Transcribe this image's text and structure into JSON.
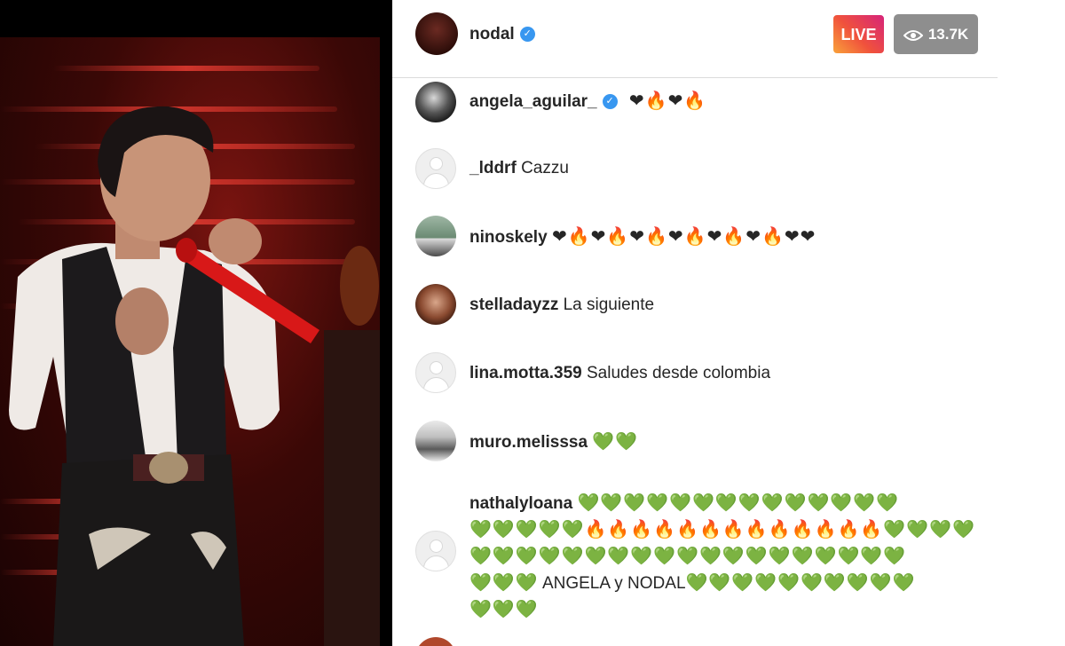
{
  "host": {
    "username": "nodal",
    "verified": true,
    "live_label": "LIVE",
    "viewer_count": "13.7K"
  },
  "comments": [
    {
      "username": "angela_aguilar_",
      "verified": true,
      "text": "",
      "emoji": "❤🔥❤🔥",
      "avatar": "photo"
    },
    {
      "username": "_lddrf",
      "verified": false,
      "text": "Cazzu",
      "emoji": "",
      "avatar": "default"
    },
    {
      "username": "ninoskely",
      "verified": false,
      "text": "",
      "emoji": "❤🔥❤🔥❤🔥❤🔥❤🔥❤🔥❤❤",
      "avatar": "photo"
    },
    {
      "username": "stelladayzz",
      "verified": false,
      "text": "La siguiente",
      "emoji": "",
      "avatar": "photo"
    },
    {
      "username": "lina.motta.359",
      "verified": false,
      "text": "Saludes desde colombia",
      "emoji": "",
      "avatar": "default"
    },
    {
      "username": "muro.melisssa",
      "verified": false,
      "text": "",
      "emoji": "💚💚",
      "avatar": "photo"
    }
  ],
  "long_comment": {
    "username": "nathalyloana",
    "line1": "💚💚💚💚💚💚💚💚💚💚💚💚💚💚",
    "line2a": "💚💚💚💚💚",
    "line2b": "🔥🔥🔥🔥🔥🔥🔥🔥🔥🔥🔥🔥🔥",
    "line2c": "💚💚💚💚",
    "line3": "💚💚💚💚💚💚💚💚💚💚💚💚💚💚💚💚💚💚💚",
    "line4a": "💚💚💚",
    "line4_text": "ANGELA y NODAL",
    "line4b": "💚💚💚💚💚💚💚💚💚💚",
    "line5": "💚💚💚"
  },
  "colors": {
    "live_gradient_start": "#f9a23a",
    "live_gradient_end": "#d6247a",
    "verified_blue": "#3897f0",
    "viewer_badge": "#8e8e8e"
  }
}
